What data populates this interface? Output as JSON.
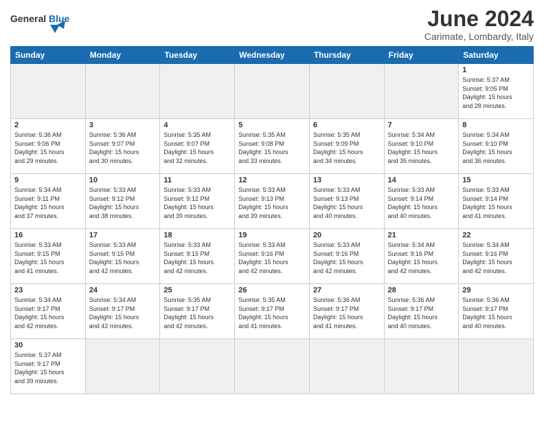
{
  "header": {
    "logo_general": "General",
    "logo_blue": "Blue",
    "title": "June 2024",
    "subtitle": "Carimate, Lombardy, Italy"
  },
  "weekdays": [
    "Sunday",
    "Monday",
    "Tuesday",
    "Wednesday",
    "Thursday",
    "Friday",
    "Saturday"
  ],
  "weeks": [
    [
      {
        "day": "",
        "info": "",
        "empty": true
      },
      {
        "day": "",
        "info": "",
        "empty": true
      },
      {
        "day": "",
        "info": "",
        "empty": true
      },
      {
        "day": "",
        "info": "",
        "empty": true
      },
      {
        "day": "",
        "info": "",
        "empty": true
      },
      {
        "day": "",
        "info": "",
        "empty": true
      },
      {
        "day": "1",
        "info": "Sunrise: 5:37 AM\nSunset: 9:05 PM\nDaylight: 15 hours\nand 28 minutes."
      }
    ],
    [
      {
        "day": "2",
        "info": "Sunrise: 5:36 AM\nSunset: 9:06 PM\nDaylight: 15 hours\nand 29 minutes."
      },
      {
        "day": "3",
        "info": "Sunrise: 5:36 AM\nSunset: 9:07 PM\nDaylight: 15 hours\nand 30 minutes."
      },
      {
        "day": "4",
        "info": "Sunrise: 5:35 AM\nSunset: 9:07 PM\nDaylight: 15 hours\nand 32 minutes."
      },
      {
        "day": "5",
        "info": "Sunrise: 5:35 AM\nSunset: 9:08 PM\nDaylight: 15 hours\nand 33 minutes."
      },
      {
        "day": "6",
        "info": "Sunrise: 5:35 AM\nSunset: 9:09 PM\nDaylight: 15 hours\nand 34 minutes."
      },
      {
        "day": "7",
        "info": "Sunrise: 5:34 AM\nSunset: 9:10 PM\nDaylight: 15 hours\nand 35 minutes."
      },
      {
        "day": "8",
        "info": "Sunrise: 5:34 AM\nSunset: 9:10 PM\nDaylight: 15 hours\nand 36 minutes."
      }
    ],
    [
      {
        "day": "9",
        "info": "Sunrise: 5:34 AM\nSunset: 9:11 PM\nDaylight: 15 hours\nand 37 minutes."
      },
      {
        "day": "10",
        "info": "Sunrise: 5:33 AM\nSunset: 9:12 PM\nDaylight: 15 hours\nand 38 minutes."
      },
      {
        "day": "11",
        "info": "Sunrise: 5:33 AM\nSunset: 9:12 PM\nDaylight: 15 hours\nand 39 minutes."
      },
      {
        "day": "12",
        "info": "Sunrise: 5:33 AM\nSunset: 9:13 PM\nDaylight: 15 hours\nand 39 minutes."
      },
      {
        "day": "13",
        "info": "Sunrise: 5:33 AM\nSunset: 9:13 PM\nDaylight: 15 hours\nand 40 minutes."
      },
      {
        "day": "14",
        "info": "Sunrise: 5:33 AM\nSunset: 9:14 PM\nDaylight: 15 hours\nand 40 minutes."
      },
      {
        "day": "15",
        "info": "Sunrise: 5:33 AM\nSunset: 9:14 PM\nDaylight: 15 hours\nand 41 minutes."
      }
    ],
    [
      {
        "day": "16",
        "info": "Sunrise: 5:33 AM\nSunset: 9:15 PM\nDaylight: 15 hours\nand 41 minutes."
      },
      {
        "day": "17",
        "info": "Sunrise: 5:33 AM\nSunset: 9:15 PM\nDaylight: 15 hours\nand 42 minutes."
      },
      {
        "day": "18",
        "info": "Sunrise: 5:33 AM\nSunset: 9:15 PM\nDaylight: 15 hours\nand 42 minutes."
      },
      {
        "day": "19",
        "info": "Sunrise: 5:33 AM\nSunset: 9:16 PM\nDaylight: 15 hours\nand 42 minutes."
      },
      {
        "day": "20",
        "info": "Sunrise: 5:33 AM\nSunset: 9:16 PM\nDaylight: 15 hours\nand 42 minutes."
      },
      {
        "day": "21",
        "info": "Sunrise: 5:34 AM\nSunset: 9:16 PM\nDaylight: 15 hours\nand 42 minutes."
      },
      {
        "day": "22",
        "info": "Sunrise: 5:34 AM\nSunset: 9:16 PM\nDaylight: 15 hours\nand 42 minutes."
      }
    ],
    [
      {
        "day": "23",
        "info": "Sunrise: 5:34 AM\nSunset: 9:17 PM\nDaylight: 15 hours\nand 42 minutes."
      },
      {
        "day": "24",
        "info": "Sunrise: 5:34 AM\nSunset: 9:17 PM\nDaylight: 15 hours\nand 42 minutes."
      },
      {
        "day": "25",
        "info": "Sunrise: 5:35 AM\nSunset: 9:17 PM\nDaylight: 15 hours\nand 42 minutes."
      },
      {
        "day": "26",
        "info": "Sunrise: 5:35 AM\nSunset: 9:17 PM\nDaylight: 15 hours\nand 41 minutes."
      },
      {
        "day": "27",
        "info": "Sunrise: 5:36 AM\nSunset: 9:17 PM\nDaylight: 15 hours\nand 41 minutes."
      },
      {
        "day": "28",
        "info": "Sunrise: 5:36 AM\nSunset: 9:17 PM\nDaylight: 15 hours\nand 40 minutes."
      },
      {
        "day": "29",
        "info": "Sunrise: 5:36 AM\nSunset: 9:17 PM\nDaylight: 15 hours\nand 40 minutes."
      }
    ],
    [
      {
        "day": "30",
        "info": "Sunrise: 5:37 AM\nSunset: 9:17 PM\nDaylight: 15 hours\nand 39 minutes."
      },
      {
        "day": "",
        "info": "",
        "empty": true
      },
      {
        "day": "",
        "info": "",
        "empty": true
      },
      {
        "day": "",
        "info": "",
        "empty": true
      },
      {
        "day": "",
        "info": "",
        "empty": true
      },
      {
        "day": "",
        "info": "",
        "empty": true
      },
      {
        "day": "",
        "info": "",
        "empty": true
      }
    ]
  ]
}
